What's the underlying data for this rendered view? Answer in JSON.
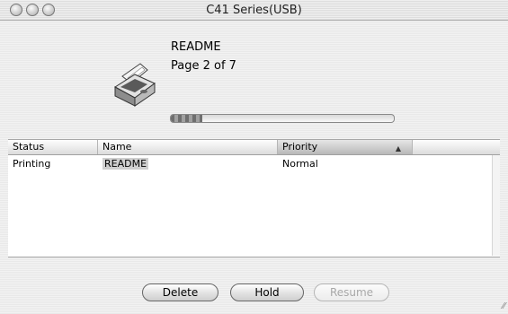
{
  "window": {
    "title": "C41 Series(USB)"
  },
  "job": {
    "document_name": "README",
    "page_info": "Page 2 of 7",
    "progress": 0.14
  },
  "list": {
    "headers": {
      "status": "Status",
      "name": "Name",
      "priority": "Priority"
    },
    "sort_indicator": "▲",
    "rows": [
      {
        "status": "Printing",
        "name": "README",
        "priority": "Normal"
      }
    ]
  },
  "buttons": {
    "delete": "Delete",
    "hold": "Hold",
    "resume": "Resume"
  },
  "icons": {
    "printer": "printer-icon",
    "sort": "sort-ascending-icon",
    "resize": "resize-grip-icon"
  }
}
